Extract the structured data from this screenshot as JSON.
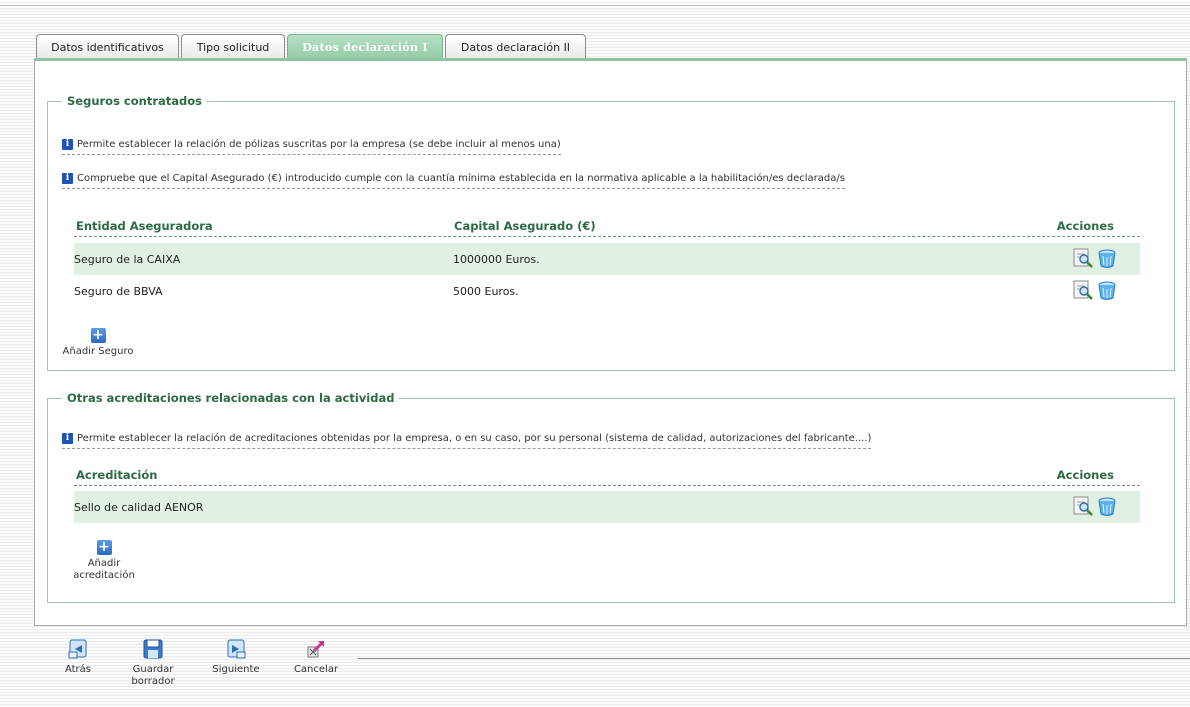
{
  "tabs": [
    {
      "label": "Datos identificativos",
      "active": false
    },
    {
      "label": "Tipo solicitud",
      "active": false
    },
    {
      "label": "Datos declaración I",
      "active": true
    },
    {
      "label": "Datos declaración II",
      "active": false
    }
  ],
  "seguros": {
    "legend": "Seguros contratados",
    "info1": "Permite establecer la relación de pólizas suscritas por la empresa (se debe incluir al menos una)",
    "info2": "Compruebe que el Capital Asegurado (€) introducido cumple con la cuantía mínima establecida en la normativa aplicable a la habilitación/es declarada/s",
    "headers": {
      "entidad": "Entidad Aseguradora",
      "capital": "Capital Asegurado (€)",
      "acciones": "Acciones"
    },
    "rows": [
      {
        "entidad": "Seguro de la CAIXA",
        "capital": "1000000 Euros."
      },
      {
        "entidad": "Seguro de BBVA",
        "capital": "5000 Euros."
      }
    ],
    "add_label": "Añadir Seguro"
  },
  "acreditaciones": {
    "legend": "Otras acreditaciones relacionadas con la actividad",
    "info1": "Permite establecer la relación de acreditaciones obtenidas por la empresa, o en su caso, por su personal (sistema de calidad, autorizaciones del fabricante....)",
    "headers": {
      "acreditacion": "Acreditación",
      "acciones": "Acciones"
    },
    "rows": [
      {
        "acreditacion": "Sello de calidad AENOR"
      }
    ],
    "add_label_line1": "Añadir",
    "add_label_line2": "acreditación"
  },
  "toolbar": {
    "back_label": "Atrás",
    "save_label_line1": "Guardar",
    "save_label_line2": "borrador",
    "next_label": "Siguiente",
    "cancel_label": "Cancelar"
  },
  "icons": {
    "info": "info-icon",
    "edit": "edit-document-icon",
    "delete": "trash-bin-icon",
    "add": "plus-icon",
    "back": "back-arrow-icon",
    "save": "floppy-disk-icon",
    "next": "next-arrow-icon",
    "cancel": "cancel-icon"
  },
  "colors": {
    "accent": "#8dc49d",
    "legend": "#2e6a45",
    "row_shade": "#e0f1e4",
    "info_icon": "#1f52b8"
  }
}
